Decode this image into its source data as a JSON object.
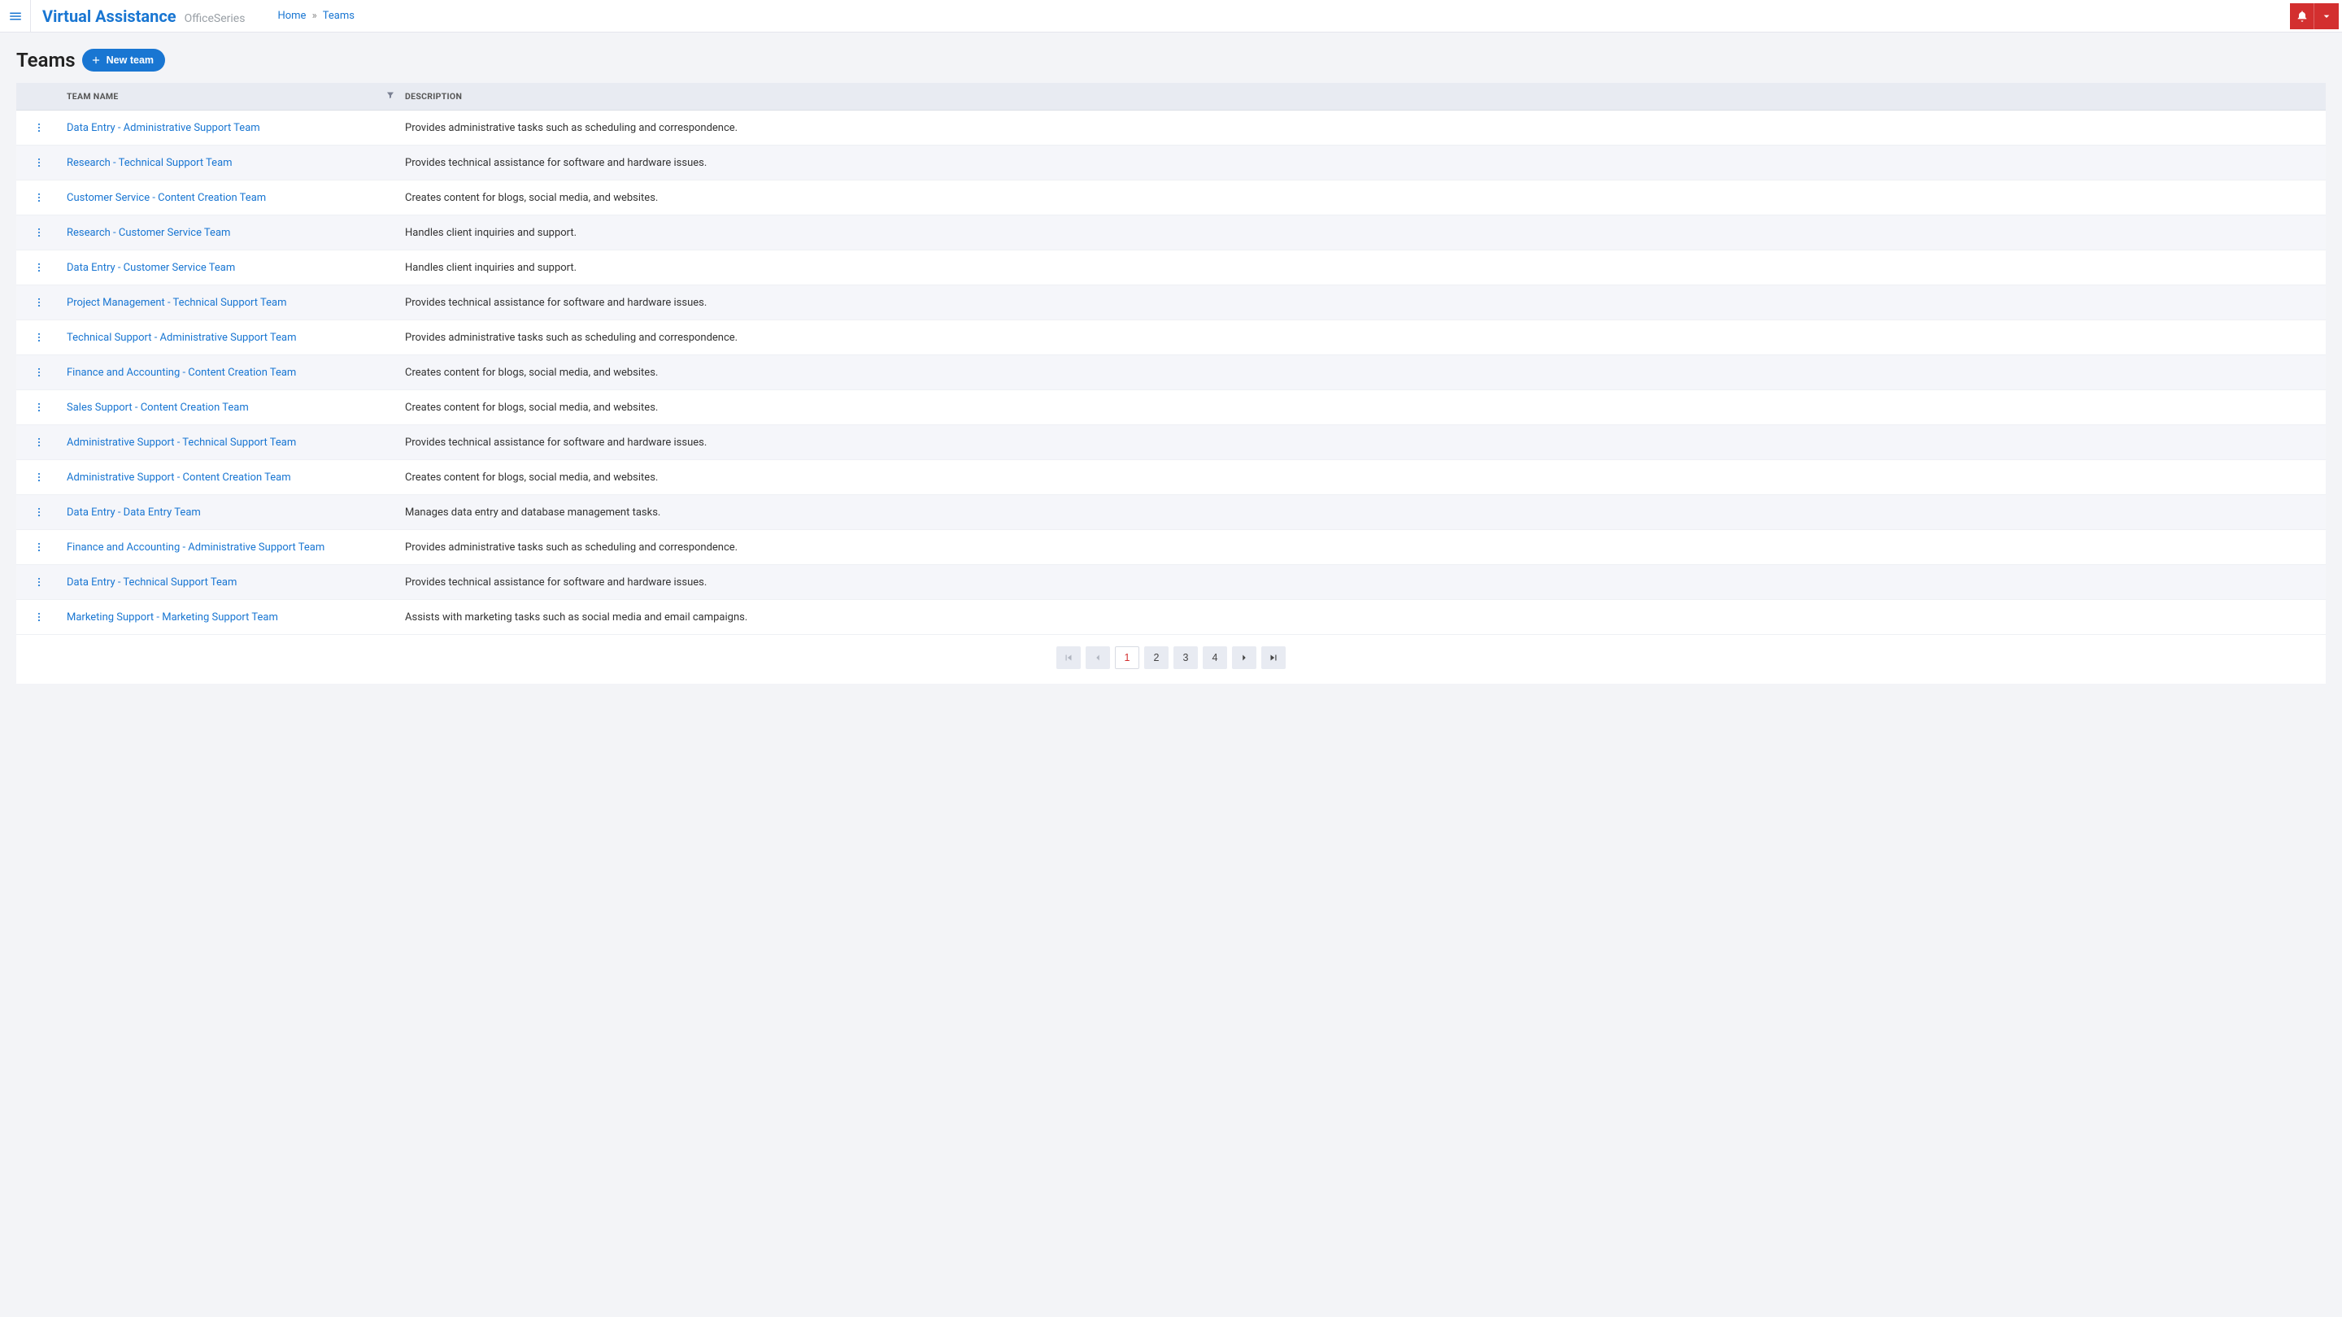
{
  "header": {
    "brand": "Virtual Assistance",
    "brand_sub": "OfficeSeries",
    "breadcrumb_home": "Home",
    "breadcrumb_sep": "»",
    "breadcrumb_current": "Teams"
  },
  "page": {
    "title": "Teams",
    "new_button": "New team"
  },
  "table": {
    "columns": {
      "name": "Team Name",
      "description": "Description"
    },
    "rows": [
      {
        "name": "Data Entry - Administrative Support Team",
        "description": "Provides administrative tasks such as scheduling and correspondence."
      },
      {
        "name": "Research - Technical Support Team",
        "description": "Provides technical assistance for software and hardware issues."
      },
      {
        "name": "Customer Service - Content Creation Team",
        "description": "Creates content for blogs, social media, and websites."
      },
      {
        "name": "Research - Customer Service Team",
        "description": "Handles client inquiries and support."
      },
      {
        "name": "Data Entry - Customer Service Team",
        "description": "Handles client inquiries and support."
      },
      {
        "name": "Project Management - Technical Support Team",
        "description": "Provides technical assistance for software and hardware issues."
      },
      {
        "name": "Technical Support - Administrative Support Team",
        "description": "Provides administrative tasks such as scheduling and correspondence."
      },
      {
        "name": "Finance and Accounting - Content Creation Team",
        "description": "Creates content for blogs, social media, and websites."
      },
      {
        "name": "Sales Support - Content Creation Team",
        "description": "Creates content for blogs, social media, and websites."
      },
      {
        "name": "Administrative Support - Technical Support Team",
        "description": "Provides technical assistance for software and hardware issues."
      },
      {
        "name": "Administrative Support - Content Creation Team",
        "description": "Creates content for blogs, social media, and websites."
      },
      {
        "name": "Data Entry - Data Entry Team",
        "description": "Manages data entry and database management tasks."
      },
      {
        "name": "Finance and Accounting - Administrative Support Team",
        "description": "Provides administrative tasks such as scheduling and correspondence."
      },
      {
        "name": "Data Entry - Technical Support Team",
        "description": "Provides technical assistance for software and hardware issues."
      },
      {
        "name": "Marketing Support - Marketing Support Team",
        "description": "Assists with marketing tasks such as social media and email campaigns."
      }
    ]
  },
  "pagination": {
    "pages": [
      "1",
      "2",
      "3",
      "4"
    ],
    "current": "1"
  }
}
